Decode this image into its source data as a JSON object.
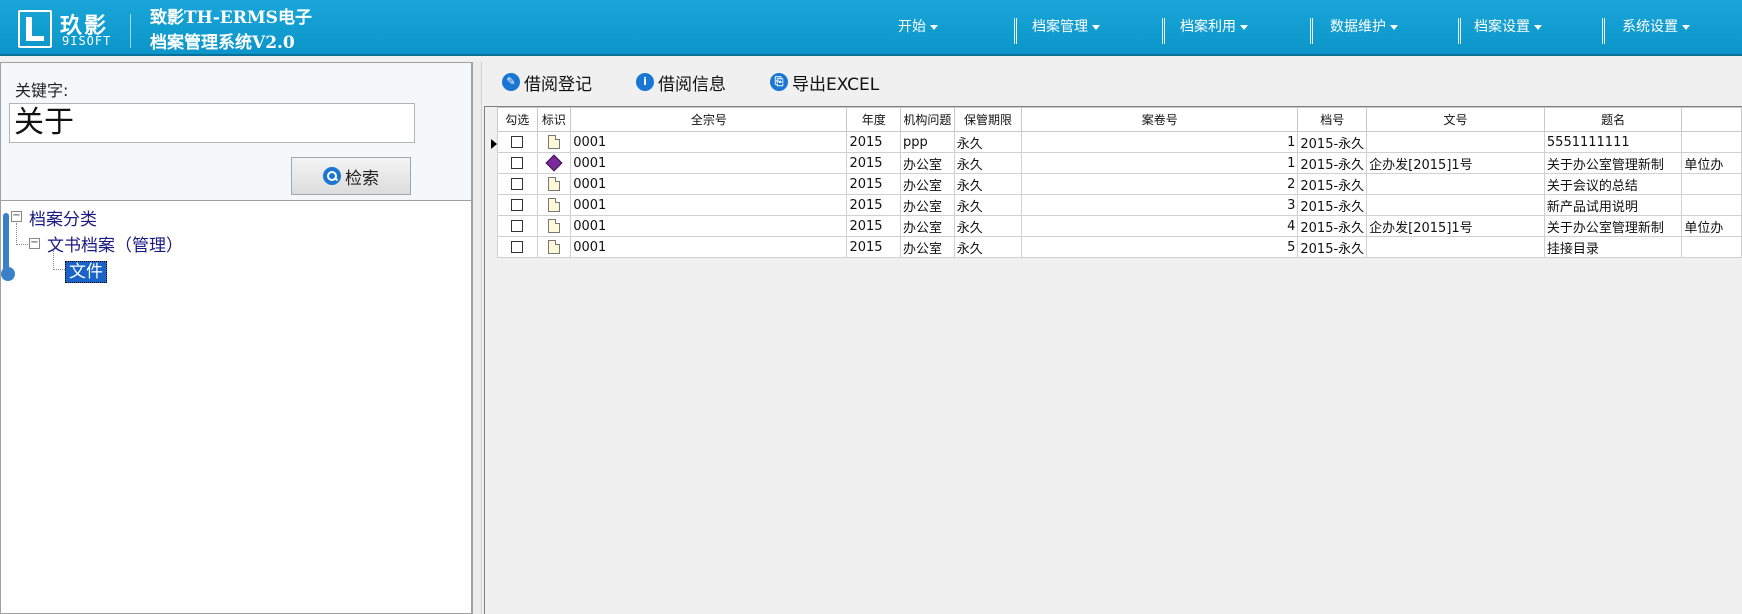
{
  "header": {
    "logo_cn": "玖影",
    "logo_en": "9ISOFT",
    "title_line1": "致影TH-ERMS电子",
    "title_line2": "档案管理系统V2.0",
    "nav": [
      "开始",
      "档案管理",
      "档案利用",
      "数据维护",
      "档案设置",
      "系统设置"
    ]
  },
  "search": {
    "label": "关键字:",
    "value": "关于",
    "button": "检索"
  },
  "tree": {
    "root": "档案分类",
    "child": "文书档案（管理）",
    "leaf": "文件"
  },
  "toolbar": {
    "borrow_register": "借阅登记",
    "borrow_info": "借阅信息",
    "export_excel": "导出EXCEL"
  },
  "grid": {
    "columns": [
      "勾选",
      "标识",
      "全宗号",
      "年度",
      "机构问题",
      "保管期限",
      "案卷号",
      "档号",
      "文号",
      "题名",
      ""
    ],
    "rows": [
      {
        "style": "red",
        "icon": "doc",
        "qzh": "0001",
        "nd": "2015",
        "jg": "ppp",
        "bg": "永久",
        "ajh": "1",
        "dh": "2015-永久",
        "wh": "",
        "tm": "5551111111",
        "extra": "",
        "current": true
      },
      {
        "style": "normal",
        "icon": "book",
        "qzh": "0001",
        "nd": "2015",
        "jg": "办公室",
        "bg": "永久",
        "ajh": "1",
        "dh": "2015-永久",
        "wh": "企办发[2015]1号",
        "tm": "关于办公室管理新制",
        "extra": "单位办",
        "current": false
      },
      {
        "style": "blue",
        "icon": "doc",
        "qzh": "0001",
        "nd": "2015",
        "jg": "办公室",
        "bg": "永久",
        "ajh": "2",
        "dh": "2015-永久",
        "wh": "",
        "tm": "关于会议的总结",
        "extra": "",
        "current": false
      },
      {
        "style": "normal",
        "icon": "doc",
        "qzh": "0001",
        "nd": "2015",
        "jg": "办公室",
        "bg": "永久",
        "ajh": "3",
        "dh": "2015-永久",
        "wh": "",
        "tm": "新产品试用说明",
        "extra": "",
        "current": false
      },
      {
        "style": "normal",
        "icon": "doc",
        "qzh": "0001",
        "nd": "2015",
        "jg": "办公室",
        "bg": "永久",
        "ajh": "4",
        "dh": "2015-永久",
        "wh": "企办发[2015]1号",
        "tm": "关于办公室管理新制",
        "extra": "单位办",
        "current": false
      },
      {
        "style": "normal",
        "icon": "doc",
        "qzh": "0001",
        "nd": "2015",
        "jg": "办公室",
        "bg": "永久",
        "ajh": "5",
        "dh": "2015-永久",
        "wh": "",
        "tm": "挂接目录",
        "extra": "",
        "current": false
      }
    ]
  }
}
